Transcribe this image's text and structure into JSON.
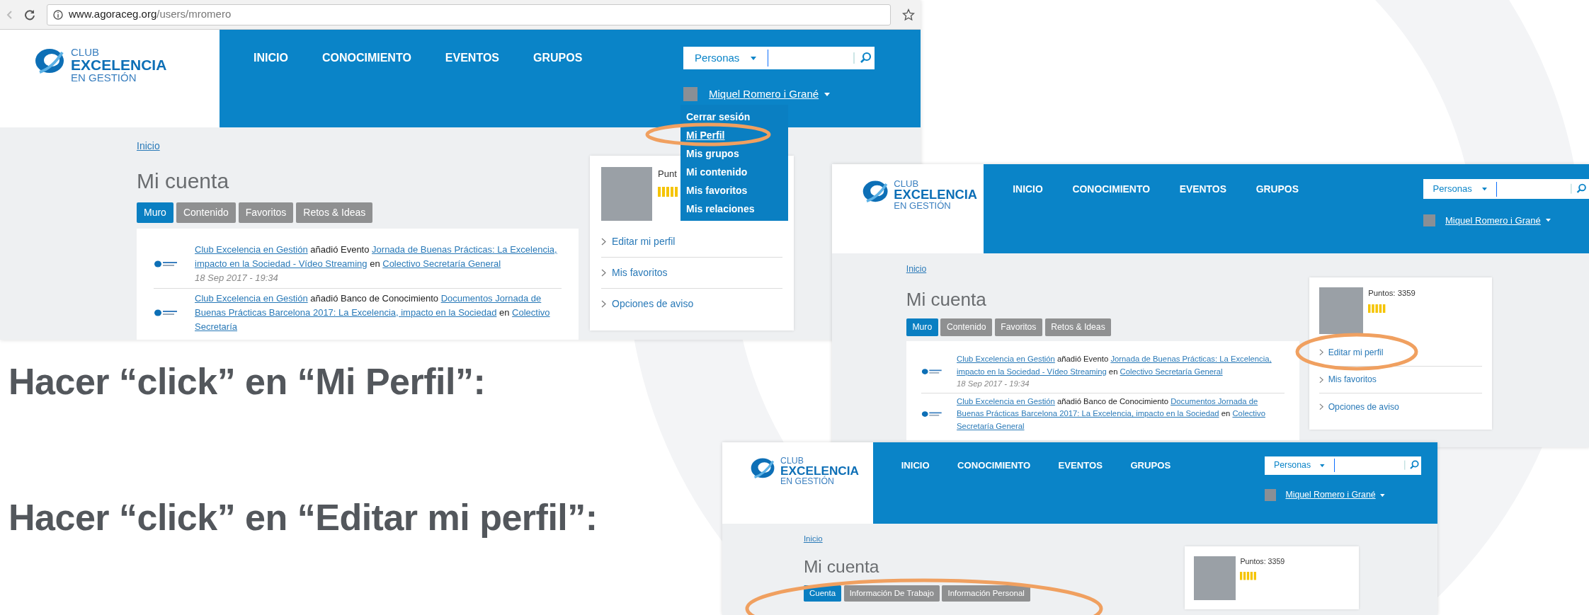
{
  "slide": {
    "instructions": [
      {
        "text": "Hacer “click” en “Mi Perfil”:"
      },
      {
        "text": "Hacer “click” en “Editar mi perfil”:"
      }
    ]
  },
  "screenshots": [
    {
      "browser": {
        "url_host": "www.agoraceg.org",
        "url_path": "/users/mromero"
      },
      "header": {
        "logo": [
          "CLUB",
          "EXCELENCIA",
          "EN GESTIÓN"
        ],
        "nav": [
          "INICIO",
          "CONOCIMIENTO",
          "EVENTOS",
          "GRUPOS"
        ],
        "search_scope": "Personas",
        "user_name": "Miquel Romero i Grané"
      },
      "user_menu": [
        {
          "label": "Cerrar sesión",
          "selected": false
        },
        {
          "label": "Mi Perfil",
          "selected": true
        },
        {
          "label": "Mis grupos",
          "selected": false
        },
        {
          "label": "Mi contenido",
          "selected": false
        },
        {
          "label": "Mis favoritos",
          "selected": false
        },
        {
          "label": "Mis relaciones",
          "selected": false
        }
      ],
      "breadcrumb": "Inicio",
      "page_title": "Mi cuenta",
      "tabs": [
        {
          "label": "Muro",
          "selected": true
        },
        {
          "label": "Contenido",
          "selected": false
        },
        {
          "label": "Favoritos",
          "selected": false
        },
        {
          "label": "Retos & Ideas",
          "selected": false
        }
      ],
      "feed": [
        {
          "parts": [
            {
              "kind": "link",
              "text": "Club Excelencia en Gestión"
            },
            {
              "kind": "plain",
              "text": "añadió Evento"
            },
            {
              "kind": "link",
              "text": "Jornada de Buenas Prácticas: La Excelencia, impacto en la Sociedad - Vídeo Streaming"
            },
            {
              "kind": "plain",
              "text": "en"
            },
            {
              "kind": "link",
              "text": "Colectivo Secretaría General"
            }
          ],
          "date": "18 Sep 2017 - 19:34"
        },
        {
          "parts": [
            {
              "kind": "link",
              "text": "Club Excelencia en Gestión"
            },
            {
              "kind": "plain",
              "text": "añadió Banco de Conocimiento"
            },
            {
              "kind": "link",
              "text": "Documentos Jornada de Buenas Prácticas Barcelona 2017: La Excelencia, impacto en la Sociedad"
            },
            {
              "kind": "plain",
              "text": "en"
            },
            {
              "kind": "link",
              "text": "Colectivo Secretaría"
            }
          ]
        }
      ],
      "profile": {
        "points": "Punt",
        "links": [
          "Editar mi perfil",
          "Mis favoritos",
          "Opciones de aviso"
        ]
      }
    },
    {
      "header": {
        "logo": [
          "CLUB",
          "EXCELENCIA",
          "EN GESTIÓN"
        ],
        "nav": [
          "INICIO",
          "CONOCIMIENTO",
          "EVENTOS",
          "GRUPOS"
        ],
        "search_scope": "Personas",
        "user_name": "Miquel Romero i Grané"
      },
      "breadcrumb": "Inicio",
      "page_title": "Mi cuenta",
      "tabs": [
        {
          "label": "Muro",
          "selected": true
        },
        {
          "label": "Contenido",
          "selected": false
        },
        {
          "label": "Favoritos",
          "selected": false
        },
        {
          "label": "Retos & Ideas",
          "selected": false
        }
      ],
      "feed": [
        {
          "parts": [
            {
              "kind": "link",
              "text": "Club Excelencia en Gestión"
            },
            {
              "kind": "plain",
              "text": "añadió Evento"
            },
            {
              "kind": "link",
              "text": "Jornada de Buenas Prácticas: La Excelencia, impacto en la Sociedad - Vídeo Streaming"
            },
            {
              "kind": "plain",
              "text": "en"
            },
            {
              "kind": "link",
              "text": "Colectivo Secretaría General"
            }
          ],
          "date": "18 Sep 2017 - 19:34"
        },
        {
          "parts": [
            {
              "kind": "link",
              "text": "Club Excelencia en Gestión"
            },
            {
              "kind": "plain",
              "text": "añadió Banco de Conocimiento"
            },
            {
              "kind": "link",
              "text": "Documentos Jornada de Buenas Prácticas Barcelona 2017: La Excelencia, impacto en la Sociedad"
            },
            {
              "kind": "plain",
              "text": "en"
            },
            {
              "kind": "link",
              "text": "Colectivo Secretaría General"
            }
          ]
        }
      ],
      "profile": {
        "points": "Puntos: 3359",
        "links": [
          "Editar mi perfil",
          "Mis favoritos",
          "Opciones de aviso"
        ]
      }
    },
    {
      "header": {
        "logo": [
          "CLUB",
          "EXCELENCIA",
          "EN GESTIÓN"
        ],
        "nav": [
          "INICIO",
          "CONOCIMIENTO",
          "EVENTOS",
          "GRUPOS"
        ],
        "search_scope": "Personas",
        "user_name": "Miquel Romero i Grané"
      },
      "breadcrumb": "Inicio",
      "page_title": "Mi cuenta",
      "tabs": [
        {
          "label": "Cuenta",
          "selected": true
        },
        {
          "label": "Información De Trabajo",
          "selected": false
        },
        {
          "label": "Información Personal",
          "selected": false
        }
      ],
      "profile": {
        "points": "Puntos: 3359"
      }
    }
  ]
}
